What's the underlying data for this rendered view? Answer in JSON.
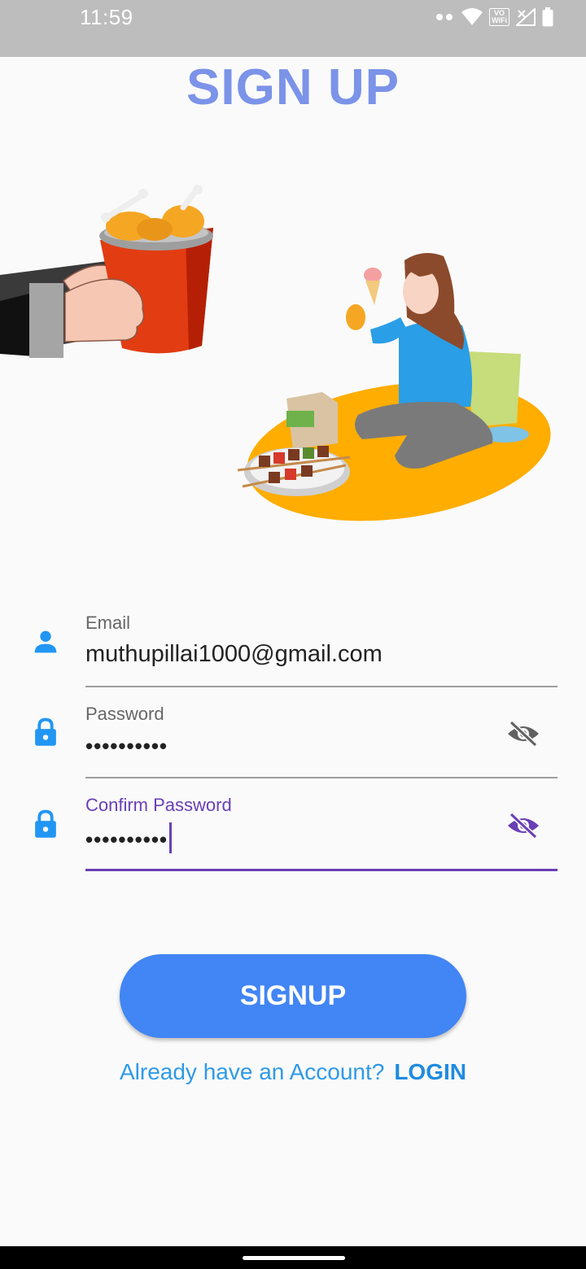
{
  "status_bar": {
    "time": "11:59",
    "icons": [
      "notification-dots-icon",
      "wifi-icon",
      "vowifi-icon",
      "signal-icon",
      "battery-icon"
    ],
    "vowifi_top": "VO",
    "vowifi_bottom": "WiFi"
  },
  "page": {
    "title": "SIGN UP"
  },
  "form": {
    "email": {
      "label": "Email",
      "value": "muthupillai1000@gmail.com",
      "icon": "person-icon"
    },
    "password": {
      "label": "Password",
      "value": "••••••••••",
      "icon": "lock-icon",
      "toggle_icon": "eye-off-icon"
    },
    "confirm_password": {
      "label": "Confirm Password",
      "value": "••••••••••",
      "icon": "lock-icon",
      "toggle_icon": "eye-off-icon"
    }
  },
  "signup_button": {
    "label": "SIGNUP"
  },
  "login_prompt": {
    "question": "Already have an Account?",
    "link": "LOGIN"
  },
  "colors": {
    "title": "#7b93e8",
    "accent": "#4285f4",
    "focus": "#6a3fb5",
    "icon_blue": "#2196f3"
  }
}
